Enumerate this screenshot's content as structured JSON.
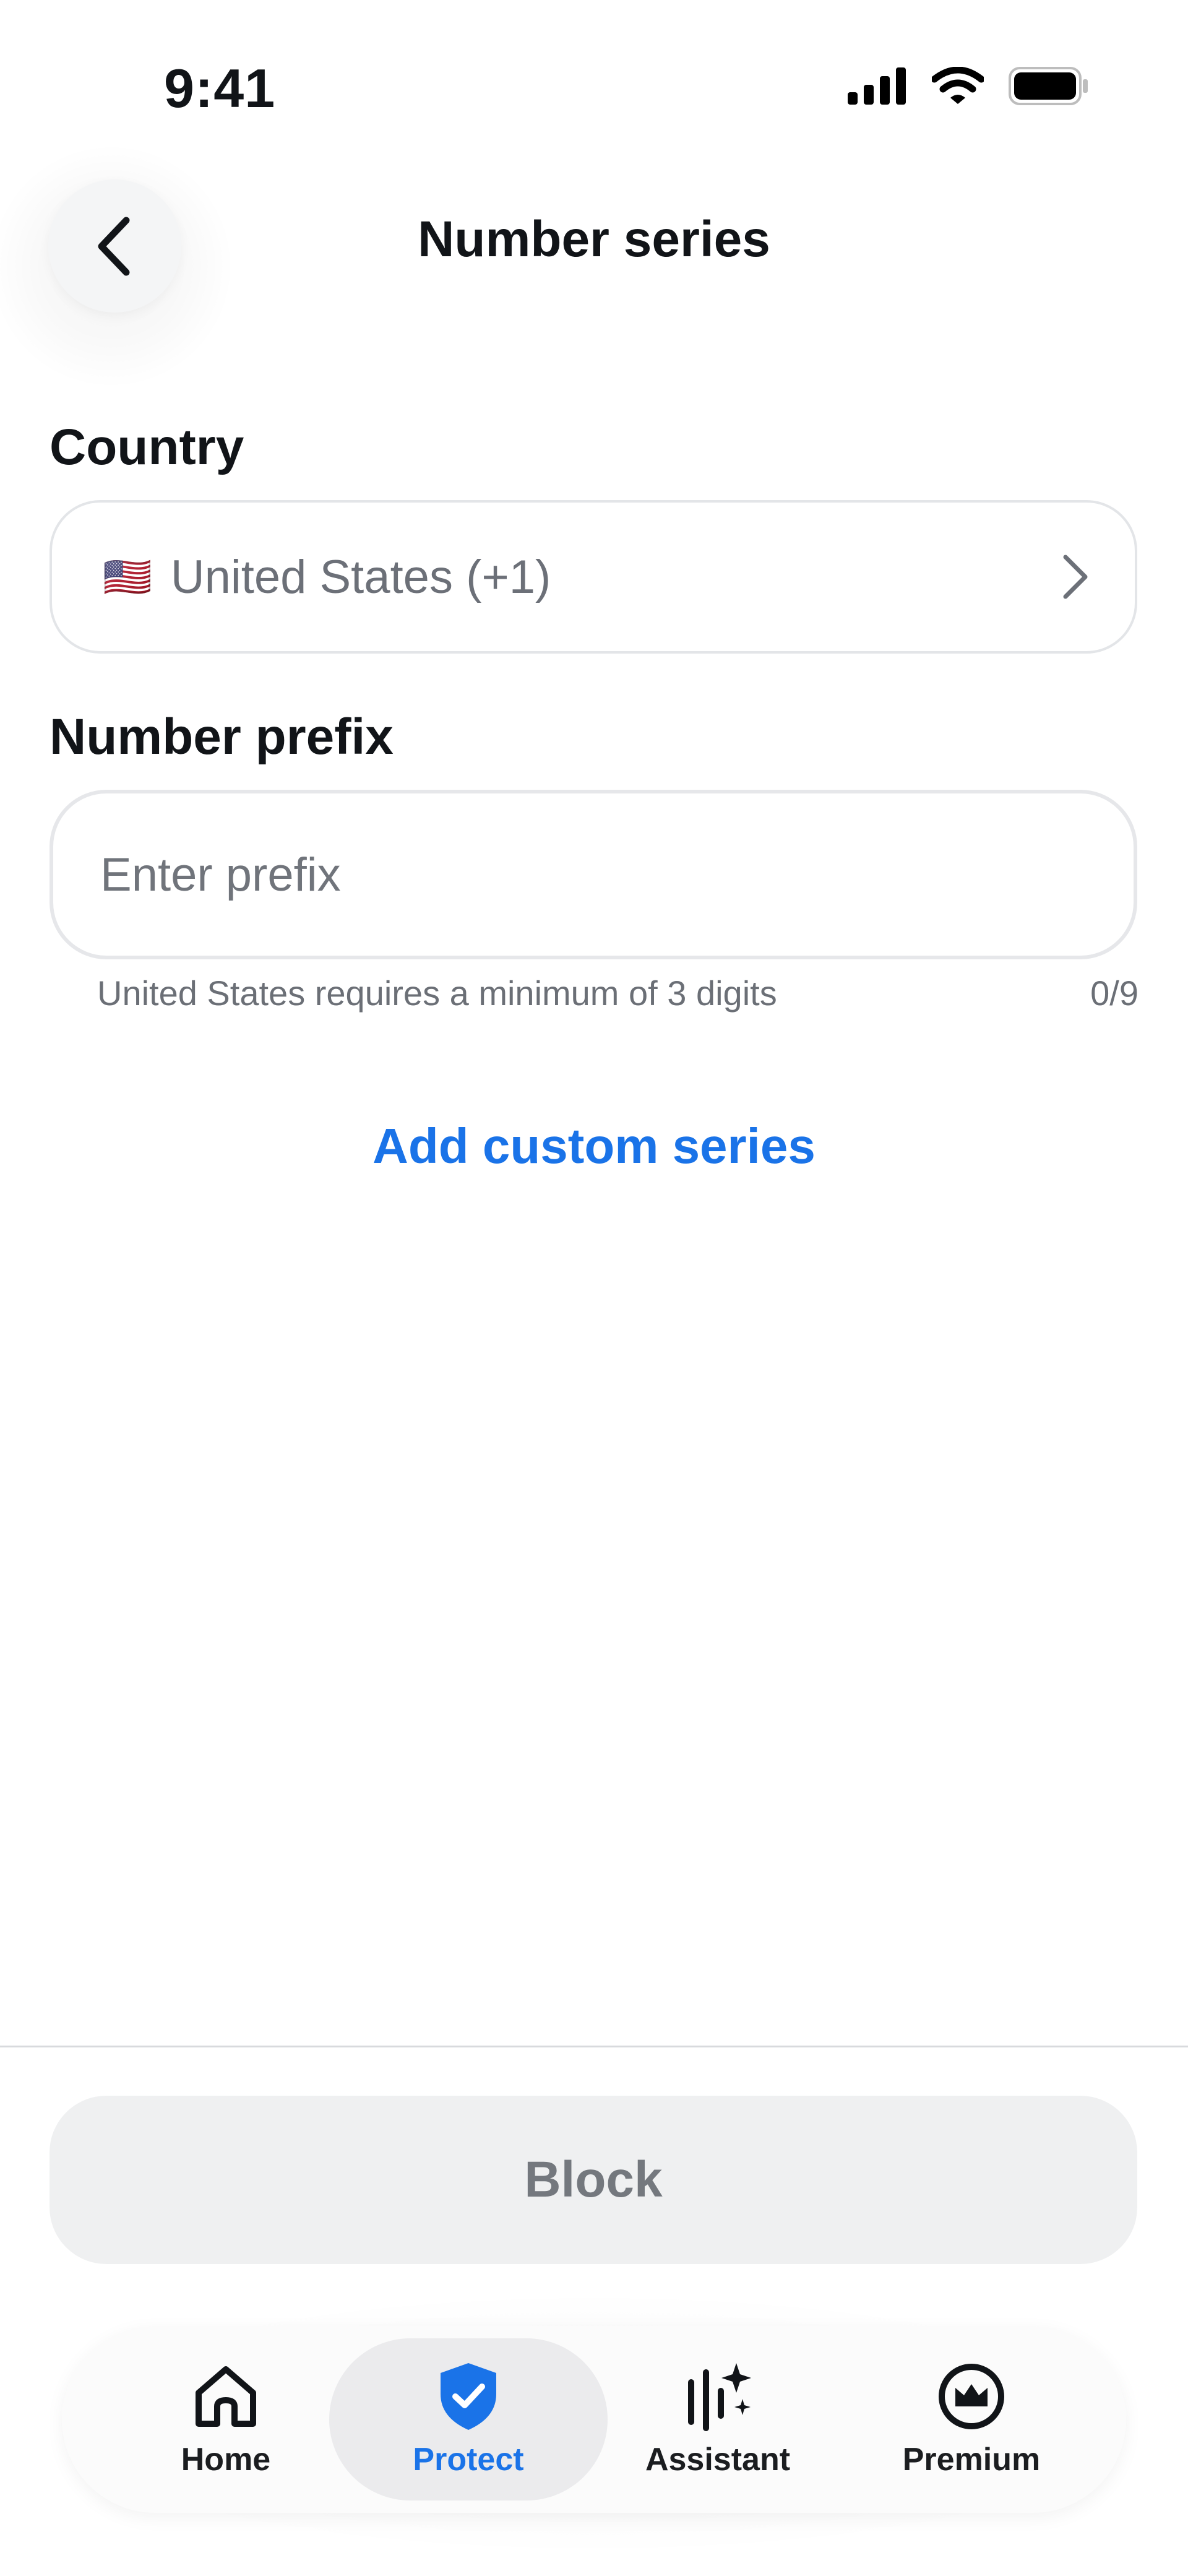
{
  "status_bar": {
    "time": "9:41"
  },
  "header": {
    "title": "Number series",
    "back_icon": "chevron-left-icon"
  },
  "country": {
    "label": "Country",
    "flag": "🇺🇸",
    "value": "United States (+1)"
  },
  "prefix": {
    "label": "Number prefix",
    "placeholder": "Enter prefix",
    "value": "",
    "helper": "United States requires a minimum of 3 digits",
    "count": "0/9"
  },
  "add_custom_series": "Add custom series",
  "block_button": "Block",
  "tabs": [
    {
      "label": "Home",
      "icon": "home-icon",
      "active": false
    },
    {
      "label": "Protect",
      "icon": "shield-check-icon",
      "active": true
    },
    {
      "label": "Assistant",
      "icon": "assistant-sparkle-icon",
      "active": false
    },
    {
      "label": "Premium",
      "icon": "crown-icon",
      "active": false
    }
  ],
  "colors": {
    "accent": "#1a73e8",
    "text": "#111418",
    "muted": "#6c7078"
  }
}
